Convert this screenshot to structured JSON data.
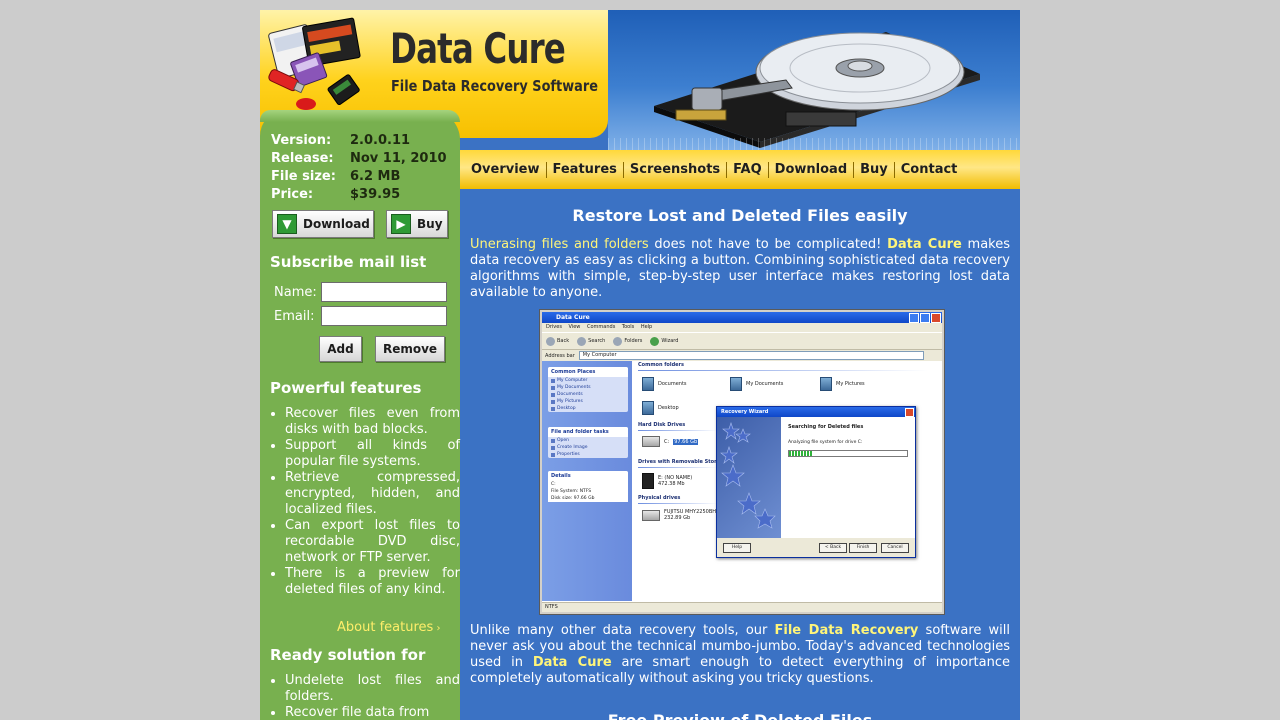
{
  "brand": {
    "title": "Data Cure",
    "subtitle": "File Data Recovery Software"
  },
  "product_info": [
    {
      "key": "Version:",
      "value": "2.0.0.11"
    },
    {
      "key": "Release:",
      "value": "Nov 11, 2010"
    },
    {
      "key": "File size:",
      "value": "6.2 MB"
    },
    {
      "key": "Price:",
      "value": "$39.95"
    }
  ],
  "sidebar": {
    "download_label": "Download",
    "buy_label": "Buy",
    "subscribe": {
      "heading": "Subscribe mail list",
      "name_label": "Name:",
      "email_label": "Email:",
      "name_value": "",
      "email_value": "",
      "add_label": "Add",
      "remove_label": "Remove"
    },
    "features": {
      "heading": "Powerful features",
      "items": [
        "Recover files even from disks with bad blocks.",
        "Support all kinds of popular file systems.",
        "Retrieve compressed, encrypted, hidden, and localized files.",
        "Can export lost files to recordable DVD disc, network or FTP server.",
        "There is a preview for deleted files of any kind."
      ],
      "about_link": "About features"
    },
    "ready": {
      "heading": "Ready solution for",
      "items": [
        "Undelete lost files and folders.",
        "Recover file data from"
      ]
    }
  },
  "nav": [
    "Overview",
    "Features",
    "Screenshots",
    "FAQ",
    "Download",
    "Buy",
    "Contact"
  ],
  "main": {
    "heading": "Restore Lost and Deleted Files easily",
    "para1": {
      "link": "Unerasing files and folders",
      "t1": " does not have to be complicated! ",
      "brand": "Data Cure",
      "t2": " makes data recovery as easy as clicking a button. Combining sophisticated data recovery algorithms with simple, step-by-step user interface makes restoring lost data available to anyone."
    },
    "para2": {
      "t1": "Unlike many other data recovery tools, our ",
      "strong1": "File Data Recovery",
      "t2": " software will never ask you about the technical mumbo-jumbo. Today's advanced technologies used in ",
      "strong2": "Data Cure",
      "t3": " are smart enough to detect everything of importance completely automatically without asking you tricky questions."
    },
    "heading2": "Free Preview of Deleted Files"
  },
  "screenshot": {
    "window_title": "Data Cure",
    "menu": [
      "Drives",
      "View",
      "Commands",
      "Tools",
      "Help"
    ],
    "toolbar": [
      "Back",
      "Search",
      "Folders",
      "Wizard"
    ],
    "address_label": "Address bar",
    "address_value": "My Computer",
    "common_places": {
      "title": "Common Places",
      "items": [
        "My Computer",
        "My Documents",
        "Documents",
        "My Pictures",
        "Desktop"
      ]
    },
    "file_tasks": {
      "title": "File and folder tasks",
      "items": [
        "Open",
        "Create Image",
        "Properties"
      ]
    },
    "details": {
      "title": "Details",
      "lines": [
        "C:",
        "File System: NTFS",
        "Disk size: 97.66 Gb"
      ]
    },
    "common_folders": {
      "title": "Common folders",
      "items": [
        "Documents",
        "My Documents",
        "My Pictures",
        "Desktop"
      ]
    },
    "hard_disk_drives": {
      "title": "Hard Disk Drives",
      "drive": "C:",
      "size": "97.66 Gb"
    },
    "removable": {
      "title": "Drives with Removable Storage",
      "name": "E: (NO NAME)",
      "size": "472.38 Mb"
    },
    "physical": {
      "title": "Physical drives",
      "name": "FUJITSU MHY2250BH",
      "size": "232.89 Gb"
    },
    "status": "NTFS",
    "wizard": {
      "title": "Recovery Wizard",
      "heading": "Searching for Deleted files",
      "status": "Analyzing file system for drive C:",
      "progress": 0.2,
      "help": "Help",
      "back": "< Back",
      "finish": "Finish",
      "cancel": "Cancel"
    }
  }
}
